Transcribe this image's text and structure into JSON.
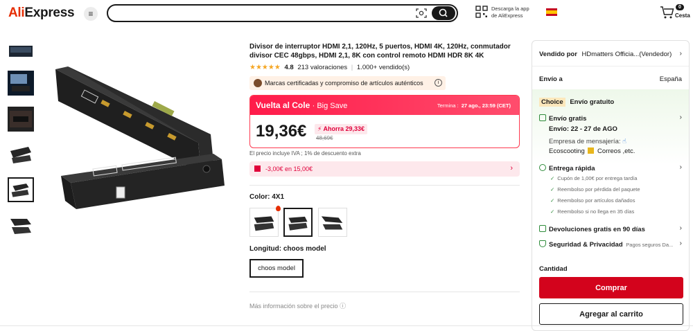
{
  "header": {
    "logo_ali": "Ali",
    "logo_express": "Express",
    "search_placeholder": "",
    "app_line1": "Descarga la app",
    "app_line2": "de AliExpress",
    "cart_count": "0",
    "cart_label": "Cesta"
  },
  "product": {
    "title": "Divisor de interruptor HDMI 2,1, 120Hz, 5 puertos, HDMI 4K, 120Hz, conmutador divisor CEC 48gbps, HDMI 2,1, 8K con control remoto HDMI HDR 8K 4K",
    "stars": "★★★★★",
    "rating_score": "4.8",
    "rating_count": "213 valoraciones",
    "sold": "1.000+ vendido(s)",
    "brand_note": "Marcas certificadas y compromiso de artículos auténticos",
    "promo_name": "Vuelta al Cole",
    "promo_sub": "· Big Save",
    "promo_ends_label": "Termina :",
    "promo_ends": "27 ago., 23:59 (CET)",
    "price": "19,36€",
    "saving": "Ahorra 29,33€",
    "old_price": "48,69€",
    "iva_note": "El precio incluye IVA ; 1% de descuento extra",
    "coupon": "-3,00€ en 15,00€",
    "color_label": "Color: 4X1",
    "length_label": "Longitud: choos model",
    "length_option": "choos model",
    "more_info": "Más información sobre el precio"
  },
  "panel": {
    "seller_label": "Vendido por",
    "seller_name": "HDmatters Officia...(Vendedor)",
    "ship_to_label": "Envío a",
    "ship_to": "España",
    "choice_badge": "Choice",
    "free_shipping": "Envío gratuito",
    "free_shipping_title": "Envío gratis",
    "delivery": "Envío: 22 - 27 de AGO",
    "courier_label": "Empresa de mensajería:",
    "couriers": "Ecoscooting",
    "couriers2": "Correos ,etc.",
    "fast_delivery": "Entrega rápida",
    "bullets": [
      "Cupón de 1,00€ por entrega tardía",
      "Reembolso por pérdida del paquete",
      "Reembolso por artículos dañados",
      "Reembolso si no llega en 35 días"
    ],
    "returns": "Devoluciones gratis en 90 días",
    "security": "Seguridad & Privacidad",
    "security_sub": "Pagos seguros Da...",
    "quantity_label": "Cantidad",
    "buy_button": "Comprar",
    "add_to_cart_button": "Agregar al carrito"
  },
  "colors": {
    "brand": "#e62e04",
    "buy": "#d3031c",
    "promo": "#ff1b4a",
    "star": "#f5a623",
    "green": "#2e8b3a"
  }
}
